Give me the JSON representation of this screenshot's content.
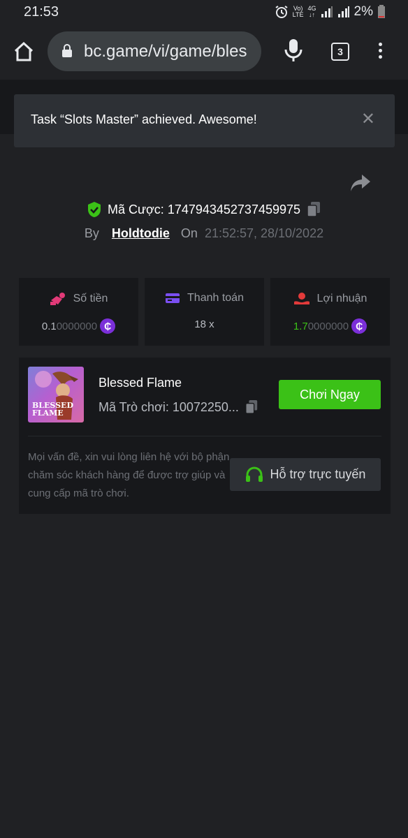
{
  "status_bar": {
    "time": "21:53",
    "battery": "2%",
    "volte": "Vo) LTE",
    "network": "4G"
  },
  "browser": {
    "url": "bc.game/vi/game/bles",
    "tab_count": "3"
  },
  "toast": {
    "message": "Task “Slots Master” achieved. Awesome!"
  },
  "bet": {
    "id_label": "Mã Cược: 1747943452737459975",
    "by_label": "By",
    "username": "Holdtodie",
    "on_label": "On",
    "datetime": "21:52:57, 28/10/2022"
  },
  "stats": [
    {
      "label": "Số tiền",
      "value_main": "0.1",
      "value_dim": "0000000",
      "icon": "amount-icon",
      "value_color": "#b9bcc2"
    },
    {
      "label": "Thanh toán",
      "value_main": "18 x",
      "value_dim": "",
      "icon": "payout-card-icon"
    },
    {
      "label": "Lợi nhuận",
      "value_main": "1.7",
      "value_dim": "0000000",
      "icon": "profit-icon",
      "value_color": "#3bc117"
    }
  ],
  "game": {
    "name": "Blessed Flame",
    "id_label": "Mã Trò chơi: 10072250...",
    "thumb_title": "BLESSED FLAME",
    "play_label": "Chơi Ngay"
  },
  "support": {
    "help_text": "Mọi vấn đề, xin vui lòng liên hệ với bộ phận chăm sóc khách hàng để được trợ giúp và cung cấp mã trò chơi.",
    "button_label": "Hỗ trợ trực tuyến"
  },
  "colors": {
    "accent_green": "#3bc117",
    "coin_purple": "#7b2fd9",
    "background": "#202124",
    "card": "#17181b"
  }
}
